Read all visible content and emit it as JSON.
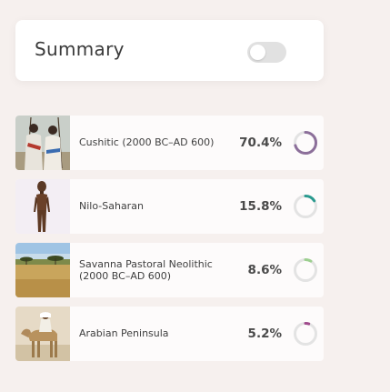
{
  "summary": {
    "title": "Summary",
    "toggle_on": false
  },
  "colors": {
    "background": "#f6f0ee",
    "ring_track": "#e3e3e3"
  },
  "ancestry": [
    {
      "label": "Cushitic (2000 BC–AD 600)",
      "percent": "70.4%",
      "value": 70.4,
      "color": "#8c6f9a",
      "image": "cushitic-herders-photo"
    },
    {
      "label": "Nilo-Saharan",
      "percent": "15.8%",
      "value": 15.8,
      "color": "#2a9a8f",
      "image": "carved-figure-photo"
    },
    {
      "label": "Savanna Pastoral Neolithic (2000 BC–AD 600)",
      "percent": "8.6%",
      "value": 8.6,
      "color": "#9ccf8f",
      "image": "savanna-landscape-photo"
    },
    {
      "label": "Arabian Peninsula",
      "percent": "5.2%",
      "value": 5.2,
      "color": "#a04a8c",
      "image": "camel-rider-photo"
    }
  ]
}
